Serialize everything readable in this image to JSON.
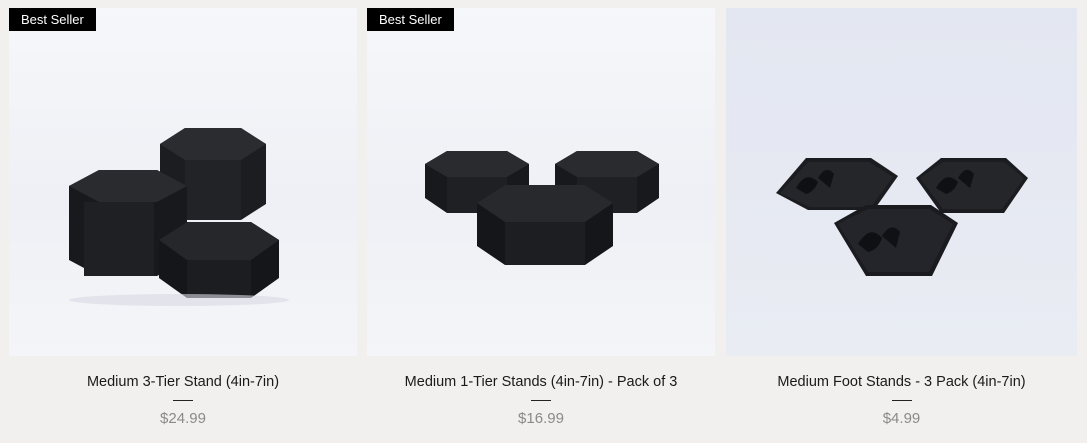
{
  "products": [
    {
      "badge": "Best Seller",
      "title": "Medium 3-Tier Stand (4in-7in)",
      "price": "$24.99",
      "image": "black hexagonal 3-tier stand"
    },
    {
      "badge": "Best Seller",
      "title": "Medium 1-Tier Stands (4in-7in) - Pack of 3",
      "price": "$16.99",
      "image": "three black hexagonal stands"
    },
    {
      "badge": "",
      "title": "Medium Foot Stands - 3 Pack (4in-7in)",
      "price": "$4.99",
      "image": "three flat black hexagonal foot stands"
    }
  ],
  "colors": {
    "badge_bg": "#000000",
    "badge_text": "#ffffff",
    "price_text": "#8a8a8a",
    "page_bg": "#f1f0ef"
  }
}
